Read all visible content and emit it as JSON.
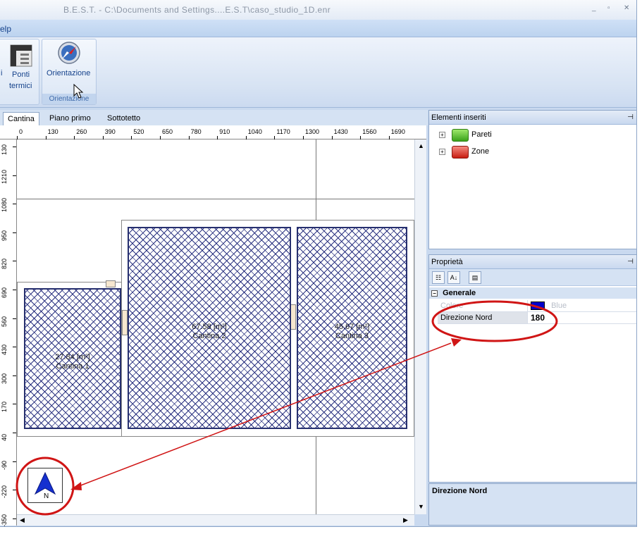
{
  "window": {
    "title": "B.E.S.T. - C:\\Documents and Settings....E.S.T\\caso_studio_1D.enr",
    "min_glyph": "_",
    "restore_glyph": "▫",
    "close_glyph": "✕"
  },
  "menu": {
    "help": "elp"
  },
  "ribbon": {
    "partial_left": "i",
    "ponti_termici_label_1": "Ponti",
    "ponti_termici_label_2": "termici",
    "orientazione_label": "Orientazione",
    "group_orientazione": "Orientazione"
  },
  "tabs": [
    "Cantina",
    "Piano primo",
    "Sottotetto"
  ],
  "hruler": [
    "0",
    "130",
    "260",
    "390",
    "520",
    "650",
    "780",
    "910",
    "1040",
    "1170",
    "1300",
    "1430",
    "1560",
    "1690"
  ],
  "vruler": [
    "130",
    "1210",
    "1080",
    "950",
    "820",
    "690",
    "560",
    "430",
    "300",
    "170",
    "40",
    "-90",
    "-220",
    "-350"
  ],
  "rooms": [
    {
      "area": "27.84 [m²]",
      "name": "Cantina 1"
    },
    {
      "area": "67.58 [m²]",
      "name": "Cantina 2"
    },
    {
      "area": "45.67 [m²]",
      "name": "Cantina 3"
    }
  ],
  "compass": {
    "letter": "N"
  },
  "elements_panel": {
    "title": "Elementi inseriti",
    "items": [
      {
        "label": "Pareti",
        "color": "#3aa21a"
      },
      {
        "label": "Zone",
        "color": "#c71d12"
      }
    ]
  },
  "properties_panel": {
    "title": "Proprietà",
    "category": "Generale",
    "rows": [
      {
        "name": "Colore",
        "value": "Blue",
        "swatch": "#0000cc"
      },
      {
        "name": "Direzione Nord",
        "value": "180"
      }
    ],
    "description_title": "Direzione Nord"
  },
  "colors": {
    "annotation": "#d01515",
    "hatch": "#2a3280"
  }
}
